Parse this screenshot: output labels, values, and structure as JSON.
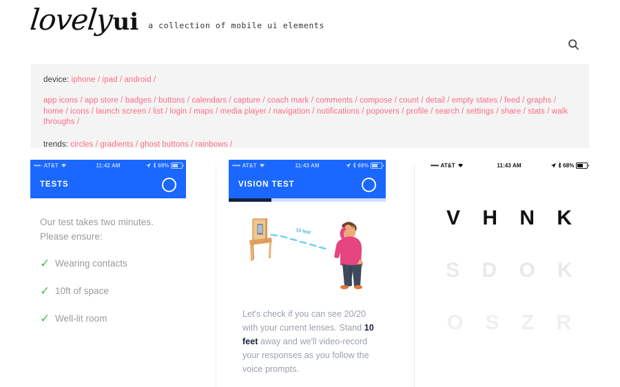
{
  "header": {
    "logo_primary": "lovely",
    "logo_secondary": "ui",
    "tagline": "a collection of mobile ui elements",
    "search_icon": "search-icon"
  },
  "nav": {
    "device_label": "device:",
    "device_links": [
      "iphone",
      "ipad",
      "android"
    ],
    "category_links": [
      "app icons",
      "app store",
      "badges",
      "buttons",
      "calendars",
      "capture",
      "coach mark",
      "comments",
      "compose",
      "count",
      "detail",
      "empty states",
      "feed",
      "graphs",
      "home",
      "icons",
      "launch screen",
      "list",
      "login",
      "maps",
      "media player",
      "navigation",
      "notifications",
      "popovers",
      "profile",
      "search",
      "settings",
      "share",
      "stats",
      "walk throughs"
    ],
    "trends_label": "trends:",
    "trends_links": [
      "circles",
      "gradients",
      "ghost buttons",
      "rainbows"
    ],
    "separator": " / ",
    "link_color": "#fb6d85",
    "panel_bg": "#f4f4f4"
  },
  "screens": {
    "one": {
      "status": {
        "dots": "••••◦",
        "carrier": "AT&T",
        "wifi_icon": "wifi-icon",
        "time": "11:42 AM",
        "location_icon": "location-arrow-icon",
        "bluetooth_icon": "bluetooth-icon",
        "battery_pct": "69%",
        "battery_level": 69
      },
      "appbar_title": "TESTS",
      "appbar_icon": "circle-ring-icon",
      "intro_line_1": "Our test takes two minutes.",
      "intro_line_2": "Please ensure:",
      "checklist": [
        "Wearing contacts",
        "10ft of space",
        "Well-lit room"
      ],
      "check_color": "#3cc13b"
    },
    "two": {
      "status": {
        "dots": "•••••",
        "carrier": "AT&T",
        "wifi_icon": "wifi-icon",
        "time": "11:43 AM",
        "location_icon": "location-arrow-icon",
        "bluetooth_icon": "bluetooth-icon",
        "battery_pct": "69%",
        "battery_level": 69
      },
      "appbar_title": "VISION TEST",
      "appbar_icon": "circle-ring-icon",
      "progress_percent": 27,
      "illustration": {
        "name": "person-10-feet-from-chair-illustration",
        "distance_label": "10 feet"
      },
      "copy_part_1": "Let's check if you can see 20/20 with your current lenses. Stand ",
      "copy_bold": "10 feet",
      "copy_part_2": " away and we'll video-record your responses as you follow the voice prompts."
    },
    "three": {
      "status": {
        "dots": "•••••",
        "carrier": "AT&T",
        "wifi_icon": "wifi-icon",
        "time": "11:43 AM",
        "location_icon": "location-arrow-icon",
        "bluetooth_icon": "bluetooth-icon",
        "battery_pct": "68%",
        "battery_level": 68
      },
      "eye_chart_rows": [
        "V H N K",
        "S D O K",
        "O S Z R"
      ]
    }
  }
}
